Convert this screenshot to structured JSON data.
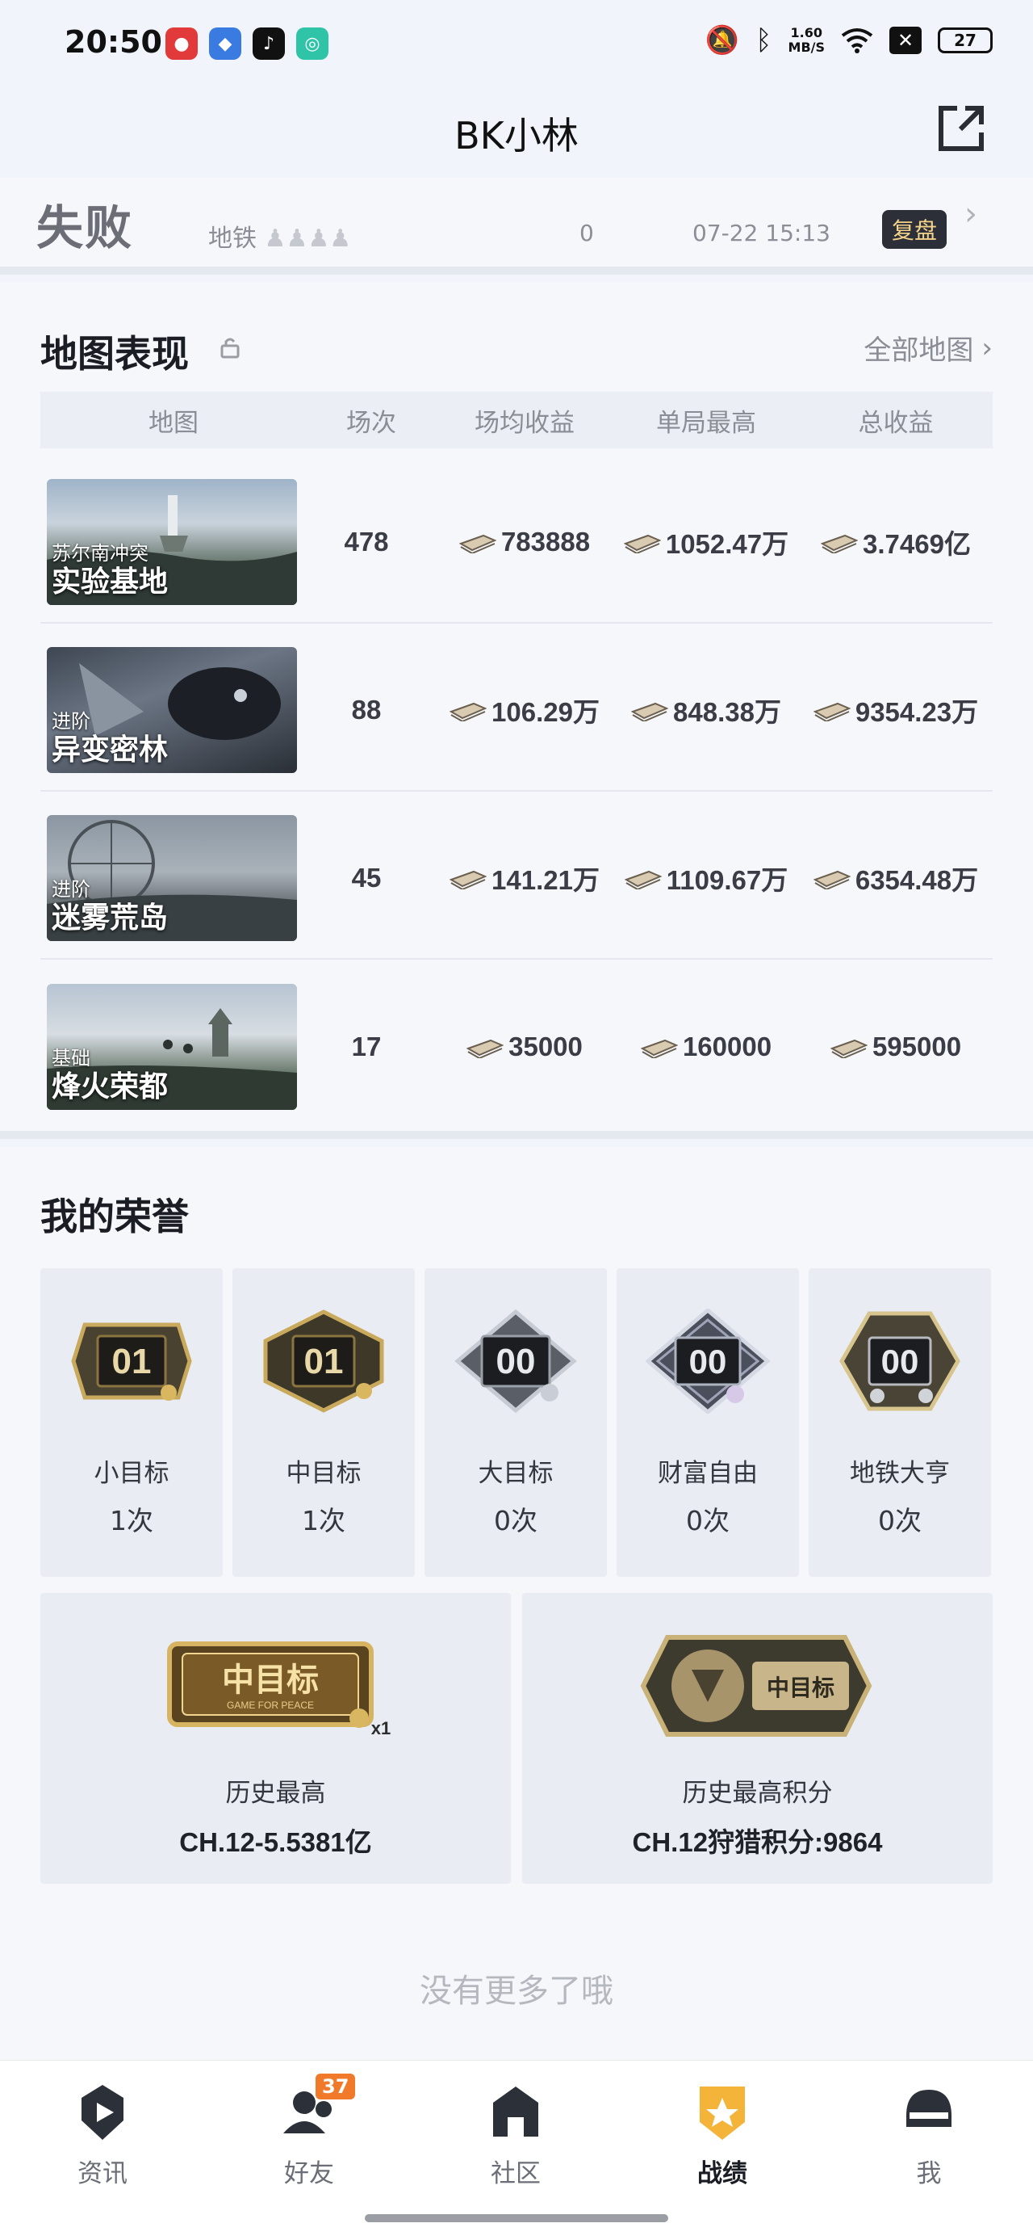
{
  "status_bar": {
    "time": "20:50",
    "speed_value": "1.60",
    "speed_unit": "MB/S",
    "battery": "27"
  },
  "header": {
    "title": "BK小林"
  },
  "previous_record": {
    "result": "失败",
    "map": "地铁",
    "value": "0",
    "time": "07-22 15:13",
    "replay_label": "复盘"
  },
  "map_section": {
    "title": "地图表现",
    "all_maps_label": "全部地图",
    "columns": [
      "地图",
      "场次",
      "场均收益",
      "单局最高",
      "总收益"
    ],
    "rows": [
      {
        "subtitle": "苏尔南冲突",
        "name": "实验基地",
        "count": "478",
        "avg": "783888",
        "best": "1052.47万",
        "total": "3.7469亿"
      },
      {
        "subtitle": "进阶",
        "name": "异变密林",
        "count": "88",
        "avg": "106.29万",
        "best": "848.38万",
        "total": "9354.23万"
      },
      {
        "subtitle": "进阶",
        "name": "迷雾荒岛",
        "count": "45",
        "avg": "141.21万",
        "best": "1109.67万",
        "total": "6354.48万"
      },
      {
        "subtitle": "基础",
        "name": "烽火荣都",
        "count": "17",
        "avg": "35000",
        "best": "160000",
        "total": "595000"
      }
    ]
  },
  "honor_section": {
    "title": "我的荣誉",
    "badges": [
      {
        "digits": "01",
        "label": "小目标",
        "count": "1次"
      },
      {
        "digits": "01",
        "label": "中目标",
        "count": "1次"
      },
      {
        "digits": "00",
        "label": "大目标",
        "count": "0次"
      },
      {
        "digits": "00",
        "label": "财富自由",
        "count": "0次"
      },
      {
        "digits": "00",
        "label": "地铁大亨",
        "count": "0次"
      }
    ],
    "big_cards": [
      {
        "badge_text": "中目标",
        "badge_sub": "GAME FOR PEACE",
        "multiplier": "x1",
        "label": "历史最高",
        "value": "CH.12-5.5381亿"
      },
      {
        "badge_text": "中目标",
        "label": "历史最高积分",
        "value": "CH.12狩猎积分:9864"
      }
    ],
    "no_more": "没有更多了哦"
  },
  "bottom_nav": {
    "items": [
      {
        "label": "资讯",
        "icon": "news-icon"
      },
      {
        "label": "好友",
        "icon": "friends-icon",
        "badge": "37"
      },
      {
        "label": "社区",
        "icon": "community-icon"
      },
      {
        "label": "战绩",
        "icon": "record-icon",
        "active": true
      },
      {
        "label": "我",
        "icon": "profile-icon"
      }
    ]
  },
  "colors": {
    "accent_orange": "#f07a2a",
    "gold": "#e8b84a",
    "background": "#f1f4fa"
  }
}
